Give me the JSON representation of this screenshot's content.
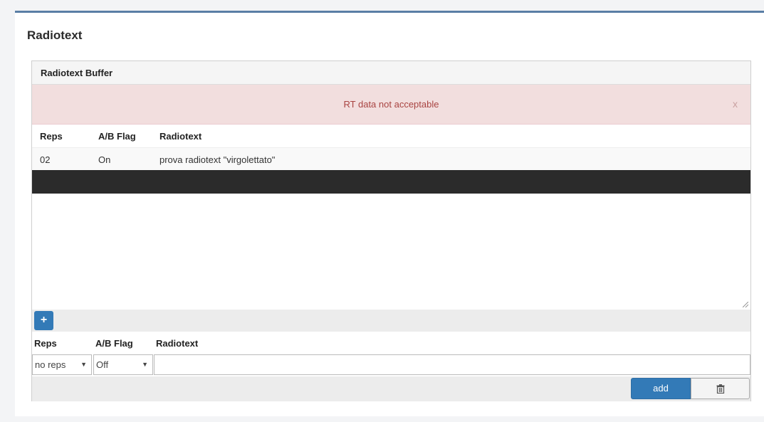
{
  "section": {
    "title": "Radiotext"
  },
  "panel": {
    "heading": "Radiotext Buffer"
  },
  "alert": {
    "message": "RT data not acceptable",
    "close": "x"
  },
  "buffer_table": {
    "columns": [
      "Reps",
      "A/B Flag",
      "Radiotext"
    ],
    "rows": [
      {
        "reps": "02",
        "ab_flag": "On",
        "radiotext": "prova radiotext \"virgolettato\""
      }
    ]
  },
  "add_toggle": {
    "label": "+"
  },
  "form": {
    "columns": [
      "Reps",
      "A/B Flag",
      "Radiotext"
    ],
    "reps_value": "no reps",
    "ab_value": "Off",
    "radiotext_value": ""
  },
  "actions": {
    "add_label": "add"
  },
  "icons": {
    "add": "plus-icon",
    "delete": "trash-icon",
    "resize": "resize-grip-icon",
    "dropdown": "chevron-down-icon"
  },
  "colors": {
    "primary": "#337ab7",
    "alert_bg": "#f2dede",
    "alert_text": "#a94442",
    "header_bar": "#5a7ea5",
    "selected_bar": "#2b2b2b"
  }
}
